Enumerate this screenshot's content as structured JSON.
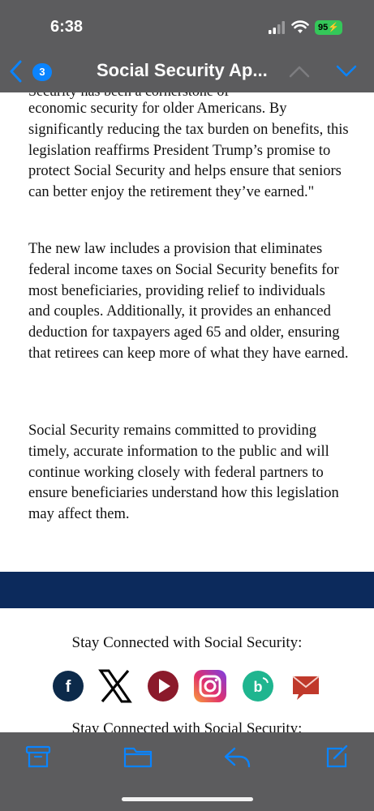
{
  "status_bar": {
    "time": "6:38",
    "battery": "95"
  },
  "nav": {
    "badge_count": "3",
    "title": "Social Security Ap..."
  },
  "article": {
    "partial_line": "Security has been a cornerstone of",
    "paragraph1": "economic security for older Americans. By significantly reducing the tax burden on benefits, this legislation reaffirms President Trump’s promise to protect Social Security and helps ensure that seniors can better enjoy the retirement they’ve earned.\"",
    "paragraph2": "The new law includes a provision that eliminates federal income taxes on Social Security benefits for most beneficiaries, providing relief to individuals and couples. Additionally, it provides an enhanced deduction for taxpayers aged 65 and older, ensuring that retirees can keep more of what they have earned.",
    "paragraph3": "Social Security remains committed to providing timely, accurate information to the public and will continue working closely with federal partners to ensure beneficiaries understand how this legislation may affect them."
  },
  "footer": {
    "stay_connected": "Stay Connected with Social Security:",
    "stay_connected_repeat": "Stay Connected with Social Security:",
    "social_icons": [
      "facebook-icon",
      "x-icon",
      "youtube-icon",
      "instagram-icon",
      "blog-icon",
      "email-icon"
    ]
  },
  "toolbar": {
    "icons": [
      "archive-icon",
      "folder-icon",
      "reply-icon",
      "compose-icon"
    ]
  },
  "colors": {
    "accent": "#0a84ff",
    "band": "#0c2a5c",
    "bar": "#5c5c5e",
    "battery": "#34c759"
  }
}
